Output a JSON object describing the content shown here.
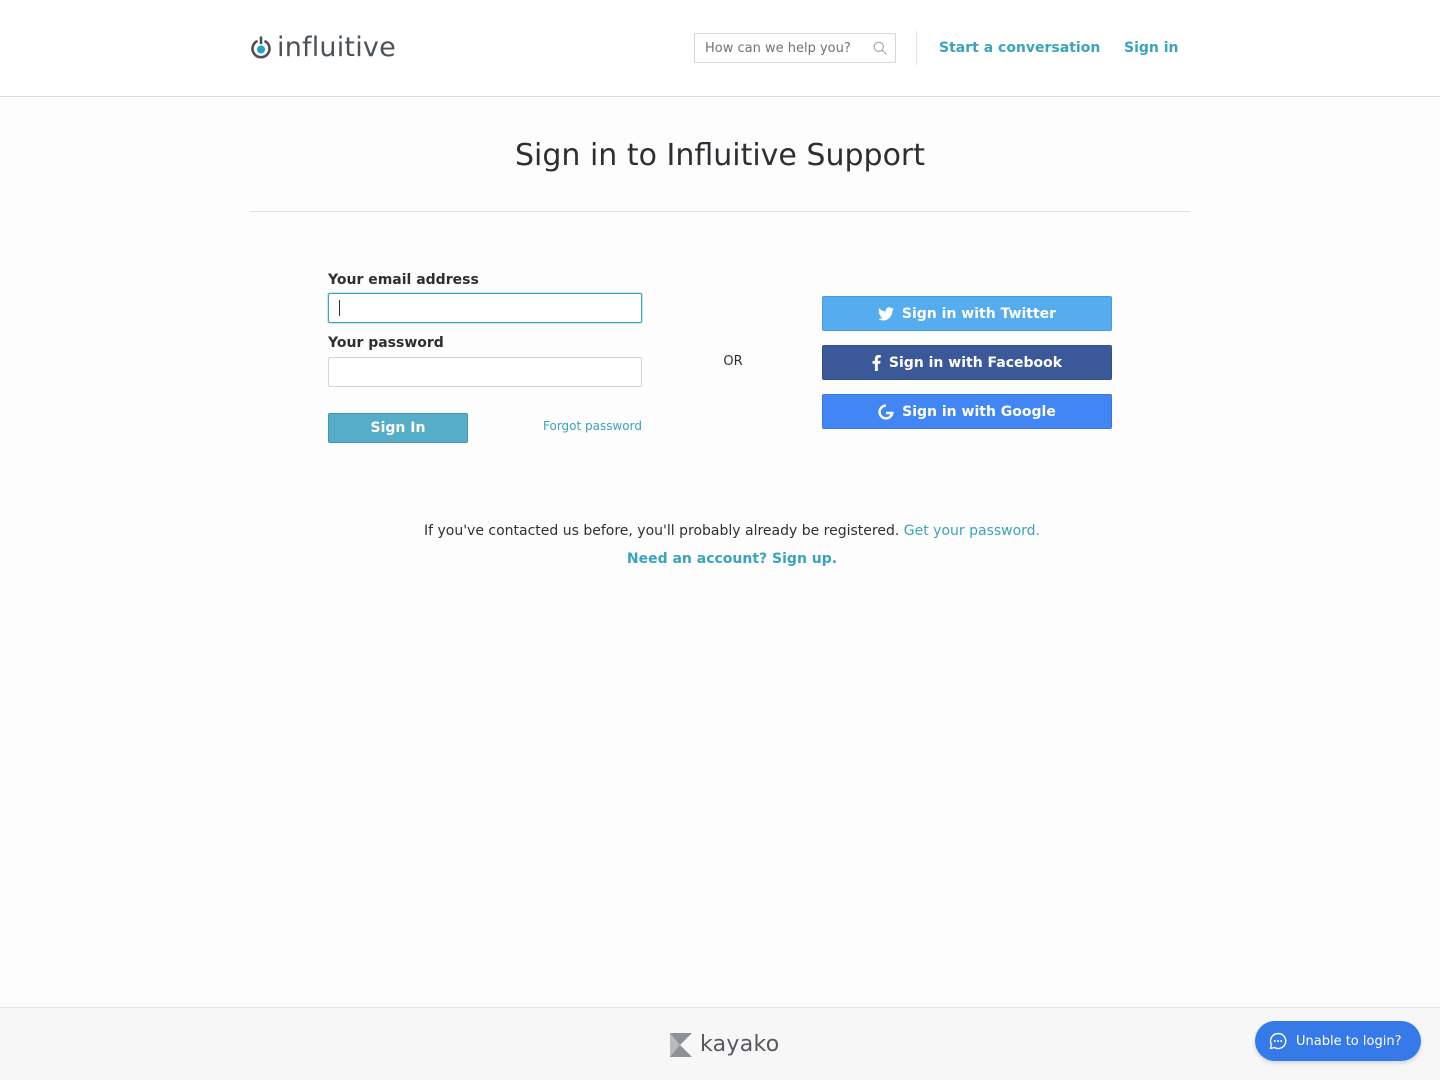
{
  "header": {
    "brand": "influitive",
    "search_placeholder": "How can we help you?",
    "nav": {
      "start_conversation": "Start a conversation",
      "sign_in": "Sign in"
    }
  },
  "main": {
    "title": "Sign in to Influitive Support",
    "form": {
      "email_label": "Your email address",
      "email_value": "",
      "password_label": "Your password",
      "password_value": "",
      "submit_label": "Sign In",
      "forgot_label": "Forgot password"
    },
    "or_label": "OR",
    "social": {
      "twitter": "Sign in with Twitter",
      "facebook": "Sign in with Facebook",
      "google": "Sign in with Google"
    },
    "info_text": "If you've contacted us before, you'll probably already be registered.",
    "info_link": "Get your password.",
    "signup_link": "Need an account? Sign up."
  },
  "footer": {
    "brand": "kayako",
    "help_button": "Unable to login?"
  },
  "colors": {
    "accent": "#3aa3bd",
    "twitter": "#55acee",
    "facebook": "#3b5998",
    "google": "#4285f4",
    "help_button": "#3679e8"
  },
  "icons": {
    "logo": "influitive-power-icon",
    "search": "search-icon",
    "twitter": "twitter-icon",
    "facebook": "facebook-icon",
    "google": "google-icon",
    "kayako": "kayako-logo-icon",
    "chat": "chat-bubble-icon"
  }
}
